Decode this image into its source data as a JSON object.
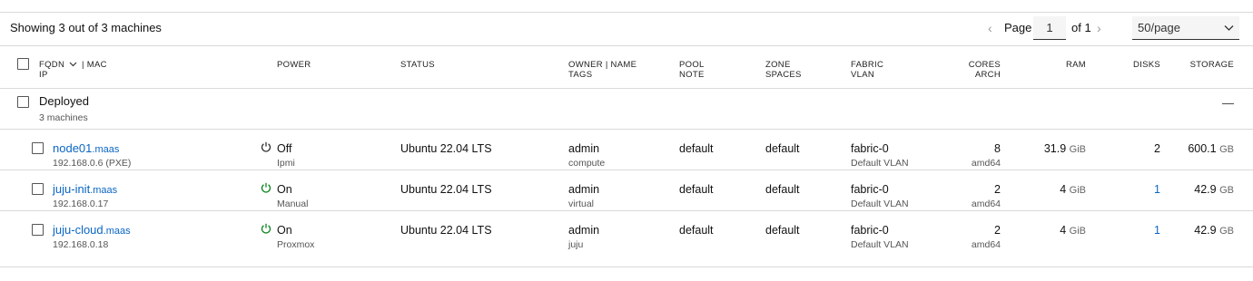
{
  "summary": "Showing 3 out of 3 machines",
  "pagination": {
    "page_label": "Page",
    "page_value": "1",
    "of_label": "of 1",
    "per_page": "50/page"
  },
  "columns": {
    "fqdn": "FQDN",
    "mac": "| MAC",
    "ip": "IP",
    "power": "POWER",
    "status": "STATUS",
    "owner": "OWNER | NAME",
    "tags": "TAGS",
    "pool": "POOL",
    "note": "NOTE",
    "zone": "ZONE",
    "spaces": "SPACES",
    "fabric": "FABRIC",
    "vlan": "VLAN",
    "cores": "CORES",
    "arch": "ARCH",
    "ram": "RAM",
    "disks": "DISKS",
    "storage": "STORAGE"
  },
  "group": {
    "name": "Deployed",
    "count": "3 machines",
    "collapse": "—"
  },
  "machines": [
    {
      "host": "node01",
      "domain": ".maas",
      "ip": "192.168.0.6 (PXE)",
      "power": "Off",
      "power_type": "Ipmi",
      "power_color": "#333333",
      "status": "Ubuntu 22.04 LTS",
      "owner": "admin",
      "tags": "compute",
      "pool": "default",
      "zone": "default",
      "fabric": "fabric-0",
      "vlan": "Default VLAN",
      "cores": "8",
      "arch": "amd64",
      "ram": "31.9",
      "ram_unit": "GiB",
      "disks": "2",
      "storage": "600.1",
      "storage_unit": "GB"
    },
    {
      "host": "juju-init",
      "domain": ".maas",
      "ip": "192.168.0.17",
      "power": "On",
      "power_type": "Manual",
      "power_color": "#0e8420",
      "status": "Ubuntu 22.04 LTS",
      "owner": "admin",
      "tags": "virtual",
      "pool": "default",
      "zone": "default",
      "fabric": "fabric-0",
      "vlan": "Default VLAN",
      "cores": "2",
      "arch": "amd64",
      "ram": "4",
      "ram_unit": "GiB",
      "disks": "1",
      "storage": "42.9",
      "storage_unit": "GB"
    },
    {
      "host": "juju-cloud",
      "domain": ".maas",
      "ip": "192.168.0.18",
      "power": "On",
      "power_type": "Proxmox",
      "power_color": "#0e8420",
      "status": "Ubuntu 22.04 LTS",
      "owner": "admin",
      "tags": "juju",
      "pool": "default",
      "zone": "default",
      "fabric": "fabric-0",
      "vlan": "Default VLAN",
      "cores": "2",
      "arch": "amd64",
      "ram": "4",
      "ram_unit": "GiB",
      "disks": "1",
      "storage": "42.9",
      "storage_unit": "GB"
    }
  ],
  "colors": {
    "link": "#0b66c3",
    "on": "#0e8420",
    "border": "#d9d9d9"
  }
}
